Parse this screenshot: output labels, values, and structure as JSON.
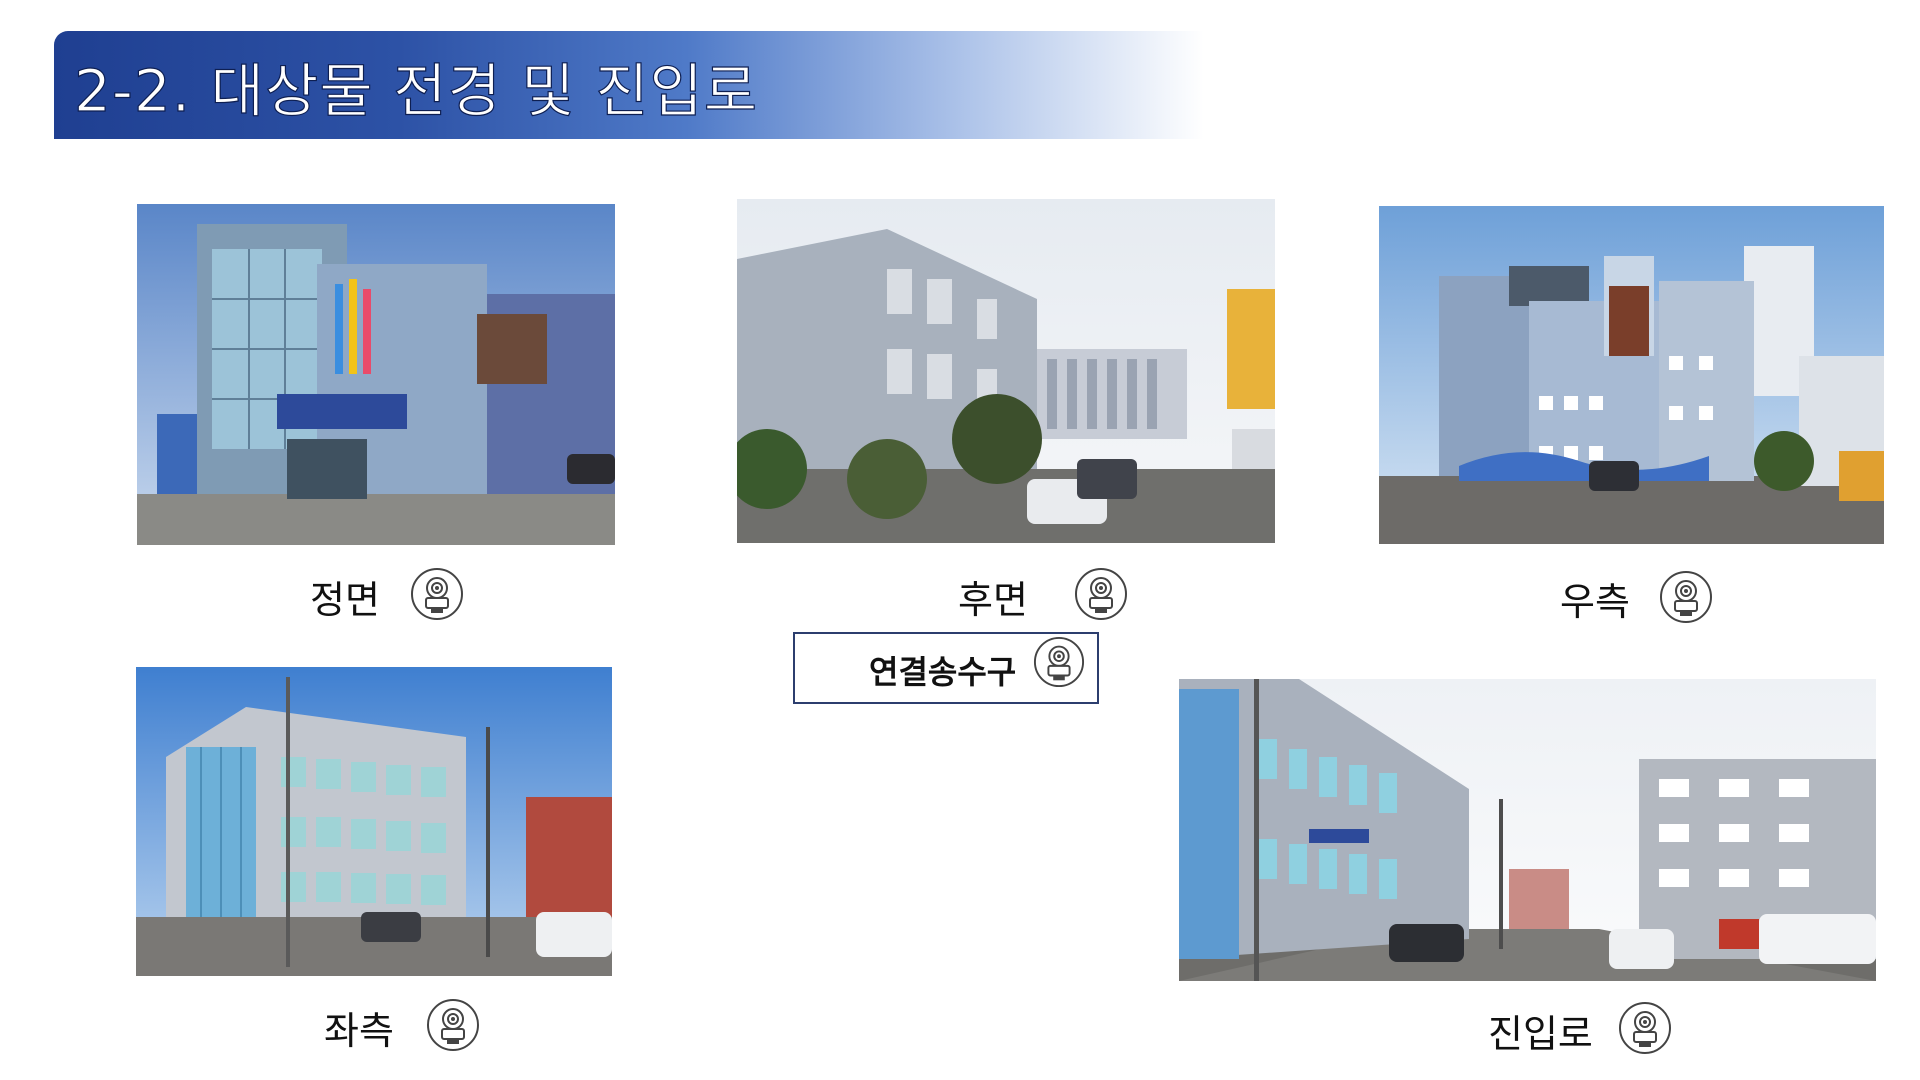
{
  "title": "2-2. 대상물 전경 및 진입로",
  "colors": {
    "title_bar_dark": "#1f3f91",
    "title_bar_light": "#a9c0e8",
    "caption_text": "#111111",
    "box_border": "#2c3e6e"
  },
  "photos": {
    "front": {
      "caption": "정면",
      "icon": "camera-360-icon"
    },
    "rear": {
      "caption": "후면",
      "icon": "camera-360-icon"
    },
    "right": {
      "caption": "우측",
      "icon": "camera-360-icon"
    },
    "left": {
      "caption": "좌측",
      "icon": "camera-360-icon"
    },
    "approach": {
      "caption": "진입로",
      "icon": "camera-360-icon"
    }
  },
  "connection": {
    "label": "연결송수구",
    "icon": "camera-360-icon"
  }
}
